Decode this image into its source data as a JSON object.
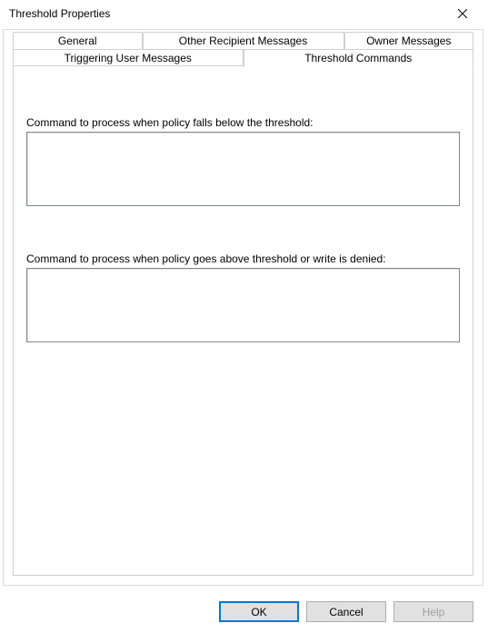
{
  "window": {
    "title": "Threshold Properties"
  },
  "tabs": {
    "row1": [
      {
        "label": "General"
      },
      {
        "label": "Other Recipient Messages"
      },
      {
        "label": "Owner Messages"
      }
    ],
    "row2": [
      {
        "label": "Triggering User Messages"
      },
      {
        "label": "Threshold Commands"
      }
    ],
    "active": "Threshold Commands"
  },
  "fields": {
    "below": {
      "label": "Command to process when policy falls below the threshold:",
      "value": ""
    },
    "above": {
      "label": "Command to process when policy goes above threshold or write is denied:",
      "value": ""
    }
  },
  "buttons": {
    "ok": "OK",
    "cancel": "Cancel",
    "help": "Help"
  }
}
